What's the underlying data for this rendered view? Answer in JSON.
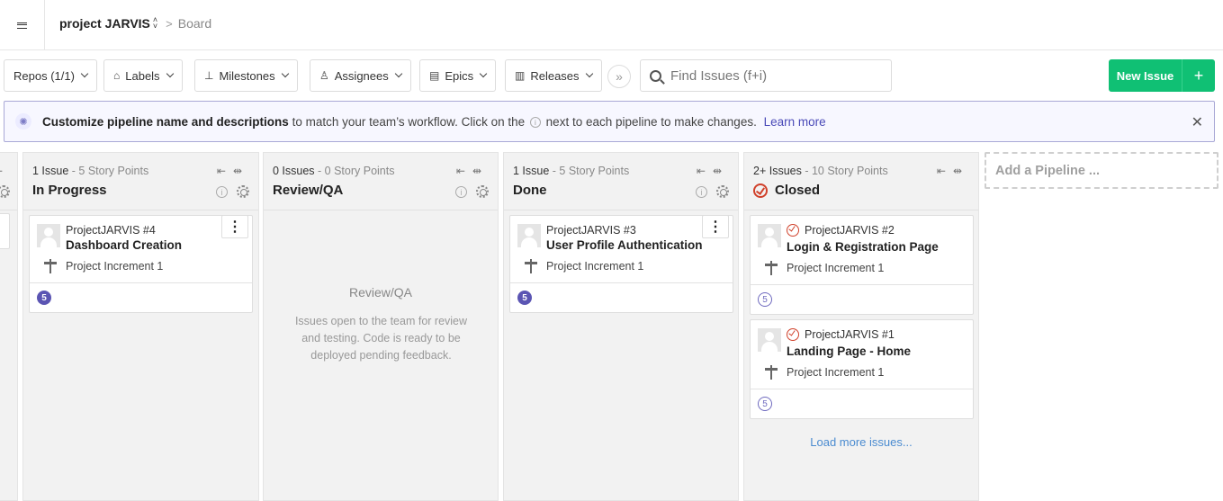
{
  "header": {
    "project": "project JARVIS",
    "separator": ">",
    "board": "Board"
  },
  "toolbar": {
    "repos": "Repos (1/1)",
    "labels": "Labels",
    "milestones": "Milestones",
    "assignees": "Assignees",
    "epics": "Epics",
    "releases": "Releases",
    "more": "»",
    "search_placeholder": "Find Issues (f+i)",
    "new_issue": "New Issue",
    "new_issue_plus": "+"
  },
  "banner": {
    "bold": "Customize pipeline name and descriptions",
    "text1": " to match your team’s workflow. Click on the ",
    "info": "i",
    "text2": " next to each pipeline to make changes. ",
    "link": "Learn more",
    "close": "✕"
  },
  "pipelines": [
    {
      "name": "In Progress",
      "count": "1 Issue",
      "points": " - 5 Story Points",
      "cards": [
        {
          "ref": "ProjectJARVIS #4",
          "title": "Dashboard Creation",
          "milestone": "Project Increment 1",
          "estimate": "5"
        }
      ]
    },
    {
      "name": "Review/QA",
      "count": "0 Issues",
      "points": " - 0 Story Points",
      "empty_title": "Review/QA",
      "empty_desc": "Issues open to the team for review and testing. Code is ready to be deployed pending feedback."
    },
    {
      "name": "Done",
      "count": "1 Issue",
      "points": " - 5 Story Points",
      "cards": [
        {
          "ref": "ProjectJARVIS #3",
          "title": "User Profile Authentication",
          "milestone": "Project Increment 1",
          "estimate": "5"
        }
      ]
    },
    {
      "name": "Closed",
      "count": "2+ Issues",
      "points": " - 10 Story Points",
      "cards": [
        {
          "ref": "ProjectJARVIS #2",
          "title": "Login & Registration Page",
          "milestone": "Project Increment 1",
          "estimate": "5"
        },
        {
          "ref": "ProjectJARVIS #1",
          "title": "Landing Page - Home",
          "milestone": "Project Increment 1",
          "estimate": "5"
        }
      ],
      "load_more": "Load more issues..."
    }
  ],
  "add_pipeline": "Add a Pipeline ...",
  "colors": {
    "accent_green": "#10c074",
    "estimate_purple": "#5b55b3",
    "closed_red": "#d0402a",
    "link_blue": "#4a8bd0"
  }
}
